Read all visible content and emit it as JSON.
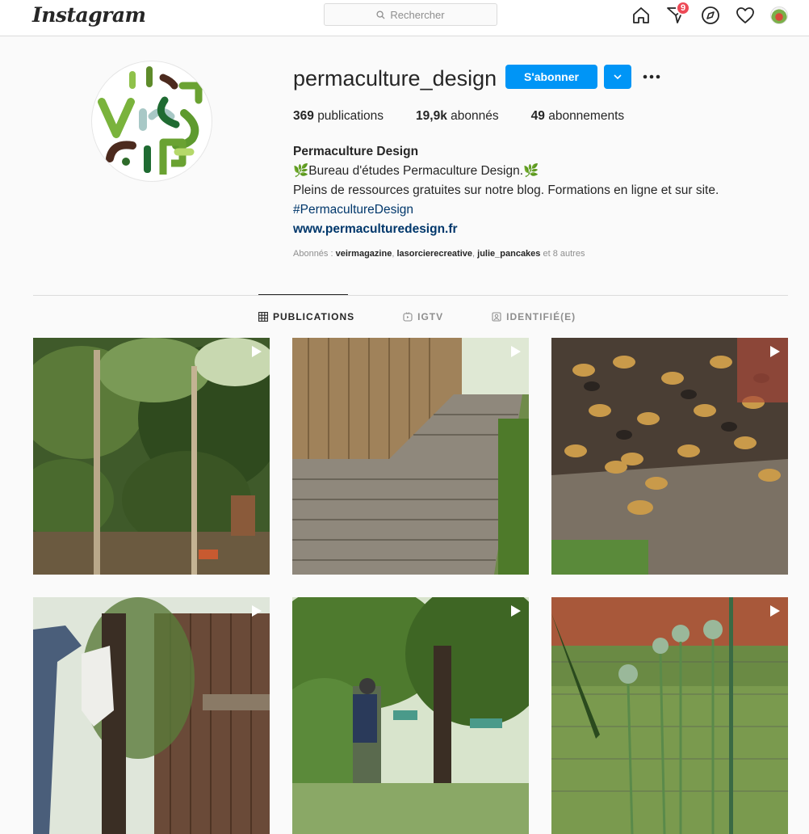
{
  "nav": {
    "logo": "Instagram",
    "search_placeholder": "Rechercher",
    "notification_count": "9",
    "icons": [
      "home-icon",
      "direct-icon",
      "explore-icon",
      "heart-icon",
      "avatar"
    ]
  },
  "profile": {
    "username": "permaculture_design",
    "follow_label": "S'abonner",
    "stats": {
      "posts_count": "369",
      "posts_label": "publications",
      "followers_count": "19,9k",
      "followers_label": "abonnés",
      "following_count": "49",
      "following_label": "abonnements"
    },
    "bio": {
      "name": "Permaculture Design",
      "line1": "🌿Bureau d'études Permaculture Design.🌿",
      "line2": "Pleins de ressources gratuites sur notre blog. Formations en ligne et sur site.",
      "hashtag": "#PermacultureDesign",
      "website": "www.permaculturedesign.fr"
    },
    "followed_by": {
      "prefix": "Abonnés :",
      "names": [
        "veirmagazine",
        "lasorcierecreative",
        "julie_pancakes"
      ],
      "others": "et 8 autres"
    }
  },
  "tabs": [
    {
      "label": "PUBLICATIONS",
      "icon": "grid-icon",
      "active": true
    },
    {
      "label": "IGTV",
      "icon": "igtv-icon",
      "active": false
    },
    {
      "label": "IDENTIFIÉ(E)",
      "icon": "tagged-icon",
      "active": false
    }
  ],
  "posts": [
    {
      "description": "garden-with-wooden-stakes",
      "type": "video"
    },
    {
      "description": "wooden-boardwalk",
      "type": "video"
    },
    {
      "description": "bees-on-hive",
      "type": "video"
    },
    {
      "description": "person-hanging-sack",
      "type": "video"
    },
    {
      "description": "person-in-garden",
      "type": "video"
    },
    {
      "description": "artichoke-plants",
      "type": "video"
    }
  ],
  "colors": {
    "accent": "#0095f6",
    "badge": "#ed4956",
    "link": "#00376b"
  }
}
